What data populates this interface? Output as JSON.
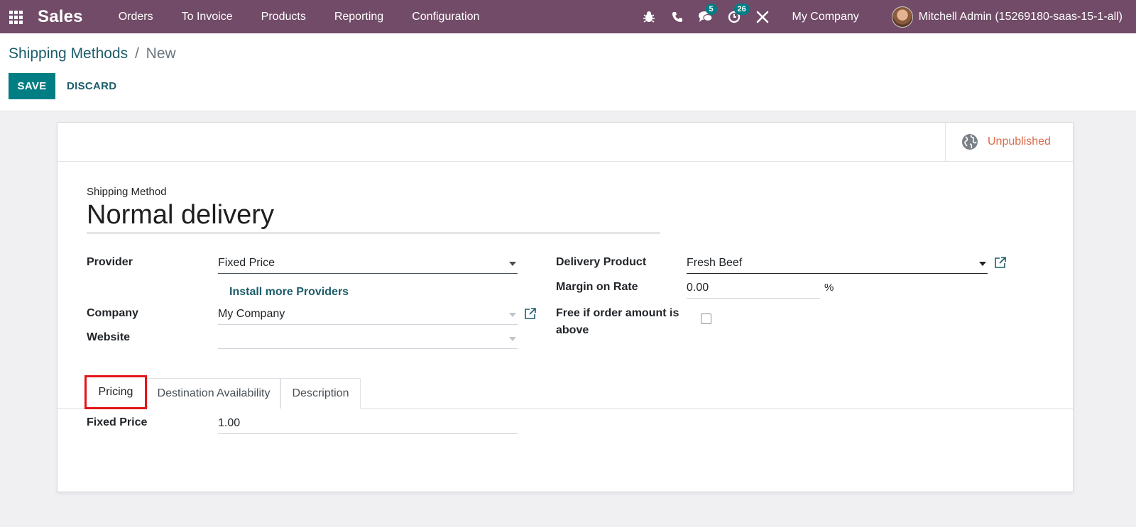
{
  "navbar": {
    "app_name": "Sales",
    "menu": [
      "Orders",
      "To Invoice",
      "Products",
      "Reporting",
      "Configuration"
    ],
    "messages_count": "5",
    "activities_count": "26",
    "company": "My Company",
    "user": "Mitchell Admin (15269180-saas-15-1-all)"
  },
  "breadcrumb": {
    "parent": "Shipping Methods",
    "separator": "/",
    "current": "New"
  },
  "actions": {
    "save": "SAVE",
    "discard": "DISCARD"
  },
  "status": {
    "publish": "Unpublished"
  },
  "form": {
    "shipping_method_label": "Shipping Method",
    "shipping_method_value": "Normal delivery",
    "provider_label": "Provider",
    "provider_value": "Fixed Price",
    "install_link": "Install more Providers",
    "company_label": "Company",
    "company_value": "My Company",
    "website_label": "Website",
    "website_value": "",
    "delivery_product_label": "Delivery Product",
    "delivery_product_value": "Fresh Beef",
    "margin_label": "Margin on Rate",
    "margin_value": "0.00",
    "margin_unit": "%",
    "free_label_line1": "Free if order amount is",
    "free_label_line2": "above",
    "free_checked": false
  },
  "tabs": [
    {
      "label": "Pricing",
      "active": true
    },
    {
      "label": "Destination Availability",
      "active": false
    },
    {
      "label": "Description",
      "active": false
    }
  ],
  "pricing": {
    "fixed_price_label": "Fixed Price",
    "fixed_price_value": "1.00"
  },
  "colors": {
    "navbar": "#714b67",
    "primary": "#017e84",
    "highlight": "#e3151a",
    "unpublished": "#dc6b4a"
  }
}
